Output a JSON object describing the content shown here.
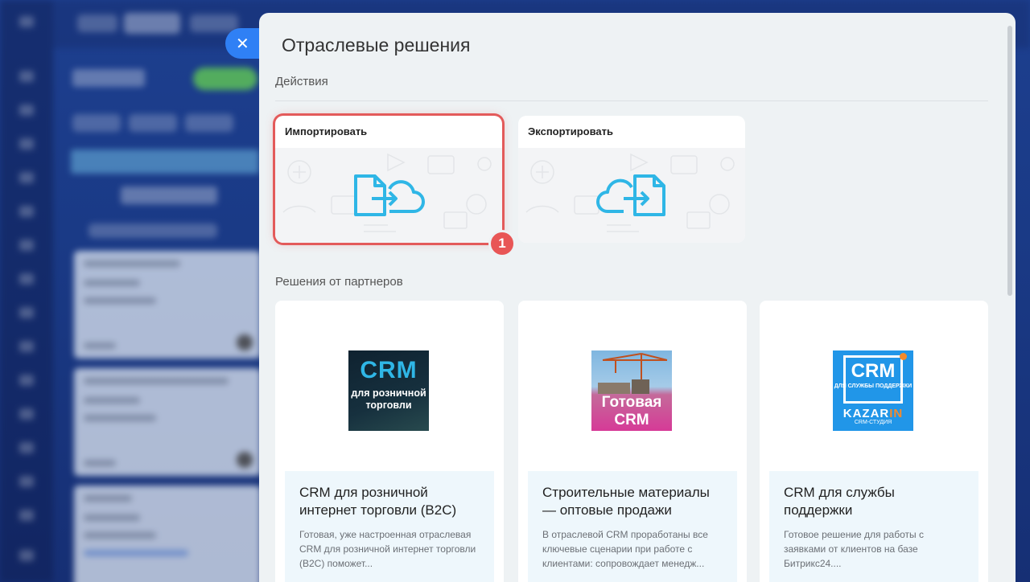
{
  "panel": {
    "title": "Отраслевые решения",
    "close_icon": "close-icon"
  },
  "actions": {
    "section_title": "Действия",
    "items": [
      {
        "label": "Импортировать",
        "icon": "import-icon",
        "selected": true
      },
      {
        "label": "Экспортировать",
        "icon": "export-icon",
        "selected": false
      }
    ],
    "badge": "1"
  },
  "partners": {
    "section_title": "Решения от партнеров",
    "items": [
      {
        "logo_text": "CRM",
        "logo_sub": "для розничной торговли",
        "title": "CRM для розничной интернет торговли (B2C)",
        "desc": "Готовая, уже настроенная отраслевая CRM для розничной интернет торговли (B2C) поможет..."
      },
      {
        "logo_text": "Готовая CRM",
        "title": "Строительные материалы — оптовые продажи",
        "desc": "В отраслевой CRM проработаны все ключевые сценарии при работе с клиентами: сопровождает менедж..."
      },
      {
        "logo_text": "CRM",
        "logo_sub": "ДЛЯ СЛУЖБЫ ПОДДЕРЖКИ",
        "logo_brand_a": "KAZAR",
        "logo_brand_b": "IN",
        "logo_studio": "CRM-СТУДИЯ",
        "title": "CRM для службы поддержки",
        "desc": "Готовое решение для работы с заявками от клиентов на базе Битрикс24...."
      }
    ]
  },
  "colors": {
    "accent": "#2f80f5",
    "highlight": "#e35a5a",
    "icon_blue": "#2fb6e6"
  }
}
